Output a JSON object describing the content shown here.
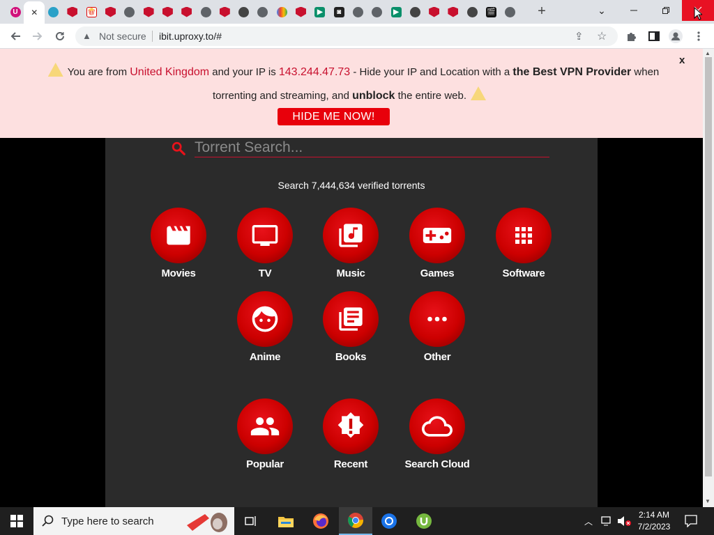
{
  "browser": {
    "tabs": [
      {
        "icon": "ubuy-icon",
        "glyph": "U"
      },
      {
        "icon": "close-tab-icon",
        "glyph": "✕",
        "active": true
      },
      {
        "icon": "ld-icon",
        "glyph": ""
      },
      {
        "icon": "mcafee-icon",
        "glyph": ""
      },
      {
        "icon": "popcorn-icon",
        "glyph": "🍿"
      },
      {
        "icon": "mcafee-icon",
        "glyph": ""
      },
      {
        "icon": "globe-icon",
        "glyph": ""
      },
      {
        "icon": "mcafee-icon",
        "glyph": ""
      },
      {
        "icon": "mcafee-icon",
        "glyph": ""
      },
      {
        "icon": "mcafee-icon",
        "glyph": ""
      },
      {
        "icon": "globe-icon",
        "glyph": ""
      },
      {
        "icon": "mcafee-icon",
        "glyph": ""
      },
      {
        "icon": "film-reel-icon",
        "glyph": ""
      },
      {
        "icon": "globe-icon",
        "glyph": ""
      },
      {
        "icon": "multicolor-icon",
        "glyph": ""
      },
      {
        "icon": "mcafee-icon",
        "glyph": ""
      },
      {
        "icon": "play-icon",
        "glyph": "▶"
      },
      {
        "icon": "dark-logo-icon",
        "glyph": "◙"
      },
      {
        "icon": "globe-icon",
        "glyph": ""
      },
      {
        "icon": "globe-icon",
        "glyph": ""
      },
      {
        "icon": "play-icon",
        "glyph": "▶"
      },
      {
        "icon": "film-reel-icon",
        "glyph": ""
      },
      {
        "icon": "mcafee-icon",
        "glyph": ""
      },
      {
        "icon": "mcafee-icon",
        "glyph": ""
      },
      {
        "icon": "film-reel-icon",
        "glyph": ""
      },
      {
        "icon": "clapperboard-icon",
        "glyph": "🎬"
      },
      {
        "icon": "globe-icon",
        "glyph": ""
      }
    ],
    "new_tab": "+",
    "security_label": "Not secure",
    "url": "ibit.uproxy.to/#"
  },
  "banner": {
    "p1": "You are from",
    "country": "United Kingdom",
    "p2": "and your IP is",
    "ip": "143.244.47.73",
    "p3": "- Hide your IP and Location with a",
    "vpn": "the Best VPN Provider",
    "p4": "when",
    "p5": "torrenting and streaming, and",
    "unblock": "unblock",
    "p6": "the entire web.",
    "button": "HIDE ME NOW!",
    "close": "x"
  },
  "search": {
    "placeholder": "Torrent Search...",
    "count_text": "Search 7,444,634 verified torrents"
  },
  "categories": [
    {
      "label": "Movies",
      "icon": "movie-clapper-icon"
    },
    {
      "label": "TV",
      "icon": "tv-icon"
    },
    {
      "label": "Music",
      "icon": "music-library-icon"
    },
    {
      "label": "Games",
      "icon": "gamepad-icon"
    },
    {
      "label": "Software",
      "icon": "apps-grid-icon"
    },
    {
      "label": "Anime",
      "icon": "smiley-face-icon"
    },
    {
      "label": "Books",
      "icon": "books-icon"
    },
    {
      "label": "Other",
      "icon": "more-dots-icon"
    },
    {
      "label": "Popular",
      "icon": "people-icon"
    },
    {
      "label": "Recent",
      "icon": "alert-badge-icon"
    },
    {
      "label": "Search Cloud",
      "icon": "cloud-icon"
    }
  ],
  "taskbar": {
    "search_placeholder": "Type here to search",
    "time": "2:14 AM",
    "date": "7/2/2023"
  },
  "colors": {
    "accent_red": "#c8102e",
    "banner_bg": "#fde0e0",
    "panel_bg": "#2b2b2b"
  }
}
